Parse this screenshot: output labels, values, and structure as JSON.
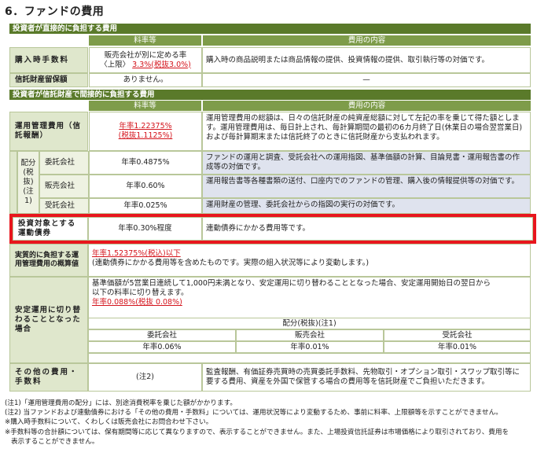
{
  "title": "6．ファンドの費用",
  "direct": {
    "header": "投資者が直接的に負担する費用",
    "col_rate": "料率等",
    "col_content": "費用の内容",
    "rows": [
      {
        "label": "購入時手数料",
        "rate_line1": "販売会社が別に定める率",
        "rate_line2_prefix": "〈上限〉",
        "rate_line2_value": "3.3%(税抜3.0%)",
        "content": "購入時の商品説明または商品情報の提供、投資情報の提供、取引執行等の対価です。"
      },
      {
        "label": "信託財産留保額",
        "rate": "ありません。",
        "content": "—"
      }
    ]
  },
  "indirect": {
    "header": "投資者が信託財産で間接的に負担する費用",
    "col_rate": "料率等",
    "col_content": "費用の内容",
    "mgmt": {
      "label": "運用管理費用（信託報酬）",
      "rate_line1": "年率1.22375%",
      "rate_line2": "(税抜1.1125%)",
      "content": "運用管理費用の総額は、日々の信託財産の純資産総額に対して左記の率を乗じて得た額とします。運用管理費用は、毎日計上され、毎計算期間の最初の6カ月終了日(休業日の場合翌営業日)および毎計算期末または信託終了のときに信託財産から支払われます。"
    },
    "alloc_label": "配分(税抜)(注1)",
    "alloc": [
      {
        "party": "委託会社",
        "rate": "年率0.4875%",
        "content": "ファンドの運用と調査、受託会社への運用指図、基準価額の計算、目論見書・運用報告書の作成等の対価です。"
      },
      {
        "party": "販売会社",
        "rate": "年率0.60%",
        "content": "運用報告書等各種書類の送付、口座内でのファンドの管理、購入後の情報提供等の対価です。"
      },
      {
        "party": "受託会社",
        "rate": "年率0.025%",
        "content": "運用財産の管理、委託会社からの指図の実行の対価です。"
      }
    ],
    "bond": {
      "label": "投資対象とする運動債券",
      "rate": "年率0.30%程度",
      "content": "連動債券にかかる費用等です。"
    },
    "effective": {
      "label": "実質的に負担する運用管理費用の概算値",
      "rate": "年率1.52375%(税込)以下",
      "content": "(連動債券にかかる費用等を含めたものです。実際の組入状況等により変動します。)"
    },
    "stable": {
      "label": "安定運用に切り替わることとなった場合",
      "line1": "基準価額が5営業日連続して1,000円未満となり、安定運用に切り替わることとなった場合、安定運用開始日の翌日から",
      "line2": "以下の料率に切り替えます。",
      "rate": "年率0.088%(税抜 0.08%)",
      "alloc_header": "配分(税抜)(注1)",
      "parties": [
        "委託会社",
        "販売会社",
        "受託会社"
      ],
      "rates": [
        "年率0.06%",
        "年率0.01%",
        "年率0.01%"
      ]
    },
    "other": {
      "label": "その他の費用・手数料",
      "rate": "(注2)",
      "content": "監査報酬、有価証券売買時の売買委託手数料、先物取引・オプション取引・スワップ取引等に要する費用、資産を外国で保管する場合の費用等を信託財産でご負担いただきます。"
    }
  },
  "notes": [
    "(注1)「運用管理費用の配分」には、別途消費税率を乗じた額がかかります。",
    "(注2) 当ファンドおよび連動債券における「その他の費用・手数料」については、運用状況等により変動するため、事前に料率、上限額等を示すことができません。",
    "※購入時手数料について、くわしくは販売会社にお問合わせ下さい。",
    "※手数料等の合計額については、保有期間等に応じて異なりますので、表示することができません。また、上場投資信託証券は市場価格により取引されており、費用を",
    "表示することができません。"
  ]
}
